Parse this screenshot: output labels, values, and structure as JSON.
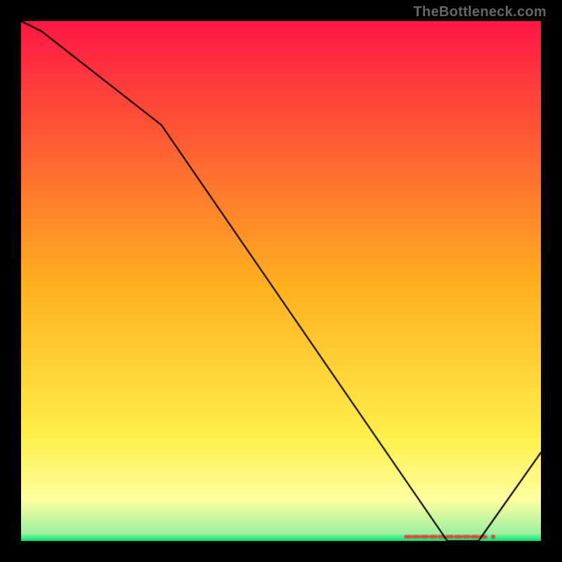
{
  "watermark": "TheBottleneck.com",
  "chart_data": {
    "type": "line",
    "title": "",
    "xlabel": "",
    "ylabel": "",
    "xlim": [
      0,
      100
    ],
    "ylim": [
      0,
      100
    ],
    "grid": false,
    "legend": false,
    "x": [
      0,
      4,
      27,
      82,
      88,
      100
    ],
    "y": [
      100,
      98,
      80,
      0,
      0,
      17
    ],
    "line_color": "#000000",
    "background_gradient": {
      "stops": [
        {
          "pos": 0.0,
          "color": "#ff1744"
        },
        {
          "pos": 0.5,
          "color": "#ffae20"
        },
        {
          "pos": 0.8,
          "color": "#fff04a"
        },
        {
          "pos": 0.92,
          "color": "#ffffa0"
        },
        {
          "pos": 0.985,
          "color": "#a0f0a0"
        },
        {
          "pos": 1.0,
          "color": "#00e676"
        }
      ]
    },
    "bottom_marker": {
      "x_start": 74,
      "x_end": 90,
      "color": "#e04a3a"
    }
  }
}
